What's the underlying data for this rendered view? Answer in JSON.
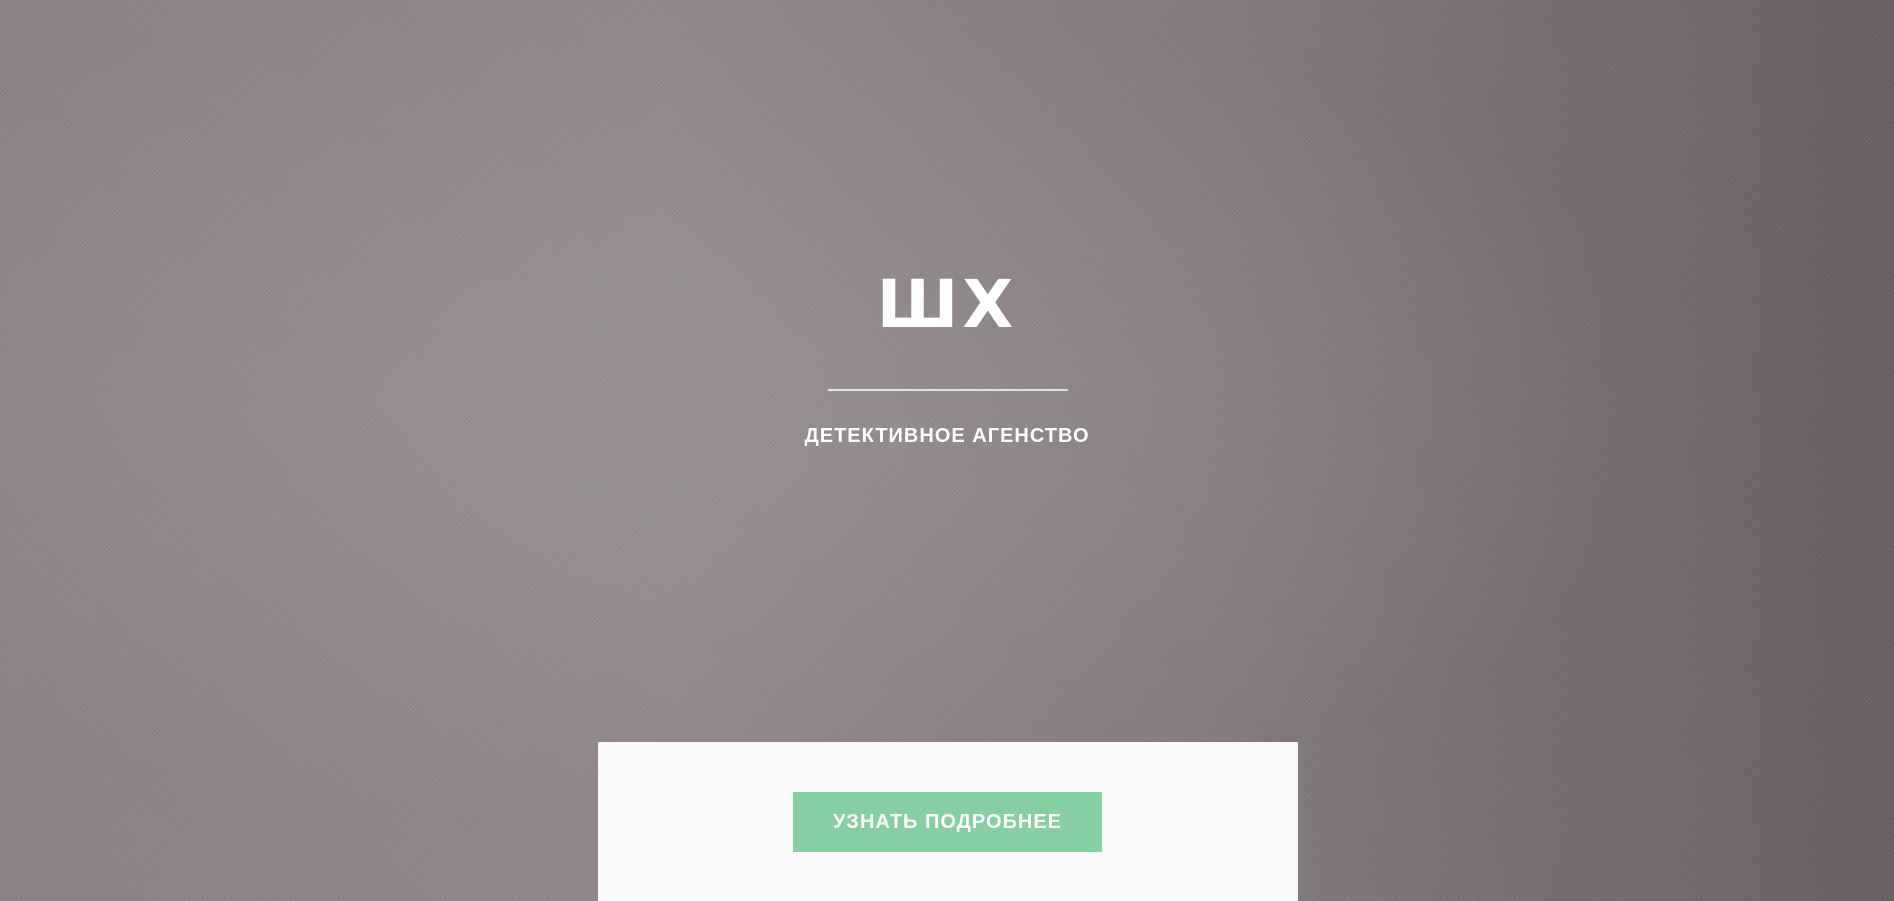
{
  "hero": {
    "logo_text": "ШХ",
    "tagline": "ДЕТЕКТИВНОЕ АГЕНСТВО"
  },
  "card": {
    "cta_label": "УЗНАТЬ ПОДРОБНЕЕ"
  },
  "colors": {
    "cta_background": "#86cfa3",
    "card_background": "#f8f8f8",
    "text": "#ffffff"
  }
}
